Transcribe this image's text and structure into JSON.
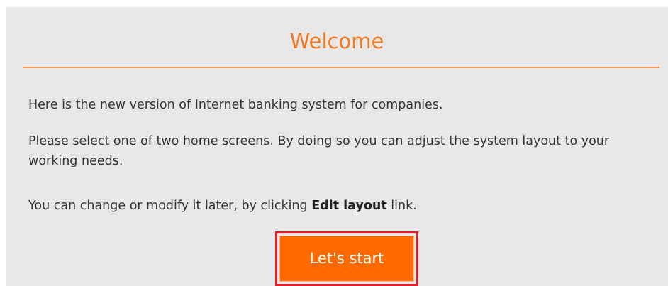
{
  "welcome": {
    "title": "Welcome",
    "paragraph1": "Here is the new version of Internet banking system for companies.",
    "paragraph2": "Please select one of two home screens. By doing so you can adjust the system layout to your working needs.",
    "paragraph3_before": "You can change or modify it later, by clicking ",
    "paragraph3_link": "Edit layout",
    "paragraph3_after": " link.",
    "start_button": "Let's start"
  },
  "colors": {
    "accent": "#f27a21",
    "button_bg": "#ff6a00",
    "highlight_border": "#e0202a",
    "panel_bg": "#e8e8e8"
  }
}
